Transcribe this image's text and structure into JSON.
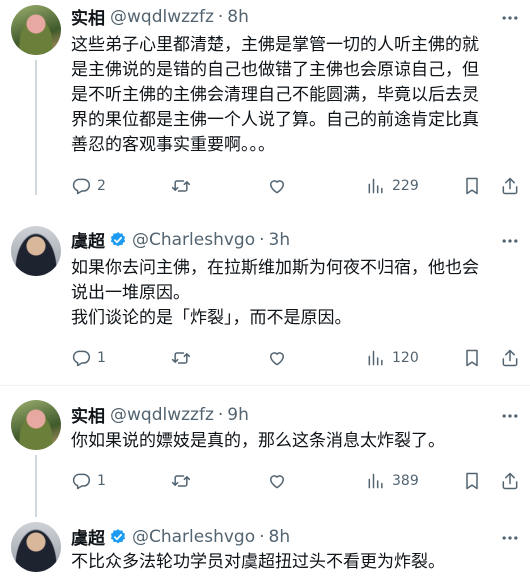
{
  "tweets": [
    {
      "name": "实相",
      "handle": "@wqdlwzzfz",
      "dot": "·",
      "time": "8h",
      "verified": false,
      "lines": [
        "这些弟子心里都清楚，主佛是掌管一切的人听主佛的就",
        "是主佛说的是错的自己也做错了主佛也会原谅自己，但",
        "是不听主佛的主佛会清理自己不能圆满，毕竟以后去灵",
        "界的果位都是主佛一个人说了算。自己的前途肯定比真",
        "善忍的客观事实重要啊。。。"
      ],
      "replies": "2",
      "retweets": "",
      "likes": "",
      "views": "229"
    },
    {
      "name": "虞超",
      "handle": "@Charleshvgo",
      "dot": "·",
      "time": "3h",
      "verified": true,
      "lines": [
        "如果你去问主佛，在拉斯维加斯为何夜不归宿，他也会",
        "说出一堆原因。",
        "我们谈论的是「炸裂」，而不是原因。"
      ],
      "replies": "1",
      "retweets": "",
      "likes": "",
      "views": "120"
    },
    {
      "name": "实相",
      "handle": "@wqdlwzzfz",
      "dot": "·",
      "time": "9h",
      "verified": false,
      "lines": [
        "你如果说的嫖妓是真的，那么这条消息太炸裂了。"
      ],
      "replies": "1",
      "retweets": "",
      "likes": "",
      "views": "389"
    },
    {
      "name": "虞超",
      "handle": "@Charleshvgo",
      "dot": "·",
      "time": "8h",
      "verified": true,
      "lines": [
        "不比众多法轮功学员对虞超扭过头不看更为炸裂。"
      ]
    }
  ],
  "colors": {
    "text": "#0f1419",
    "secondary": "#536471",
    "verified": "#1d9bf0",
    "divider": "#eff3f4"
  },
  "icons": [
    "more-icon",
    "reply-icon",
    "retweet-icon",
    "like-icon",
    "views-icon",
    "bookmark-icon",
    "share-icon",
    "verified-badge-icon"
  ]
}
